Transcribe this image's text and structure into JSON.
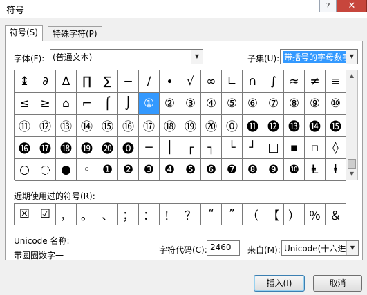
{
  "window": {
    "title": "符号",
    "help_label": "?",
    "close_label": "✕"
  },
  "tabs": [
    {
      "label": "符号(S)"
    },
    {
      "label": "特殊字符(P)"
    }
  ],
  "font": {
    "label": "字体(F):",
    "value": "(普通文本)"
  },
  "subset": {
    "label": "子集(U):",
    "value": "带括号的字母数字"
  },
  "symbol_grid": [
    [
      "↨",
      "∂",
      "∆",
      "∏",
      "∑",
      "−",
      "∕",
      "∙",
      "√",
      "∞",
      "∟",
      "∩",
      "∫",
      "≈",
      "≠",
      "≡"
    ],
    [
      "≤",
      "≥",
      "⌂",
      "⌐",
      "⌠",
      "⌡",
      "①",
      "②",
      "③",
      "④",
      "⑤",
      "⑥",
      "⑦",
      "⑧",
      "⑨",
      "⑩"
    ],
    [
      "⑪",
      "⑫",
      "⑬",
      "⑭",
      "⑮",
      "⑯",
      "⑰",
      "⑱",
      "⑲",
      "⑳",
      "⓪",
      "⓫",
      "⓬",
      "⓭",
      "⓮",
      "⓯"
    ],
    [
      "⓰",
      "⓱",
      "⓲",
      "⓳",
      "⓴",
      "⓿",
      "─",
      "│",
      "┌",
      "┐",
      "└",
      "┘",
      "□",
      "▪",
      "▫",
      "◊"
    ],
    [
      "○",
      "◌",
      "●",
      "◦",
      "❶",
      "❷",
      "❸",
      "❹",
      "❺",
      "❻",
      "❼",
      "❽",
      "❾",
      "❿",
      "Ⱡ",
      "ⱡ"
    ]
  ],
  "selected_symbol": "①",
  "recent": {
    "label": "近期使用过的符号(R):",
    "symbols": [
      "☒",
      "☑",
      "，",
      "。",
      "、",
      "；",
      "：",
      "！",
      "？",
      "“",
      "”",
      "（",
      "【",
      "）",
      "％",
      "＆"
    ]
  },
  "unicode_name": {
    "label": "Unicode 名称:",
    "value": "带圆圈数字一"
  },
  "char_code": {
    "label": "字符代码(C):",
    "value": "2460"
  },
  "from": {
    "label": "来自(M):",
    "value": "Unicode(十六进"
  },
  "buttons": {
    "insert": "插入(I)",
    "cancel": "取消"
  }
}
